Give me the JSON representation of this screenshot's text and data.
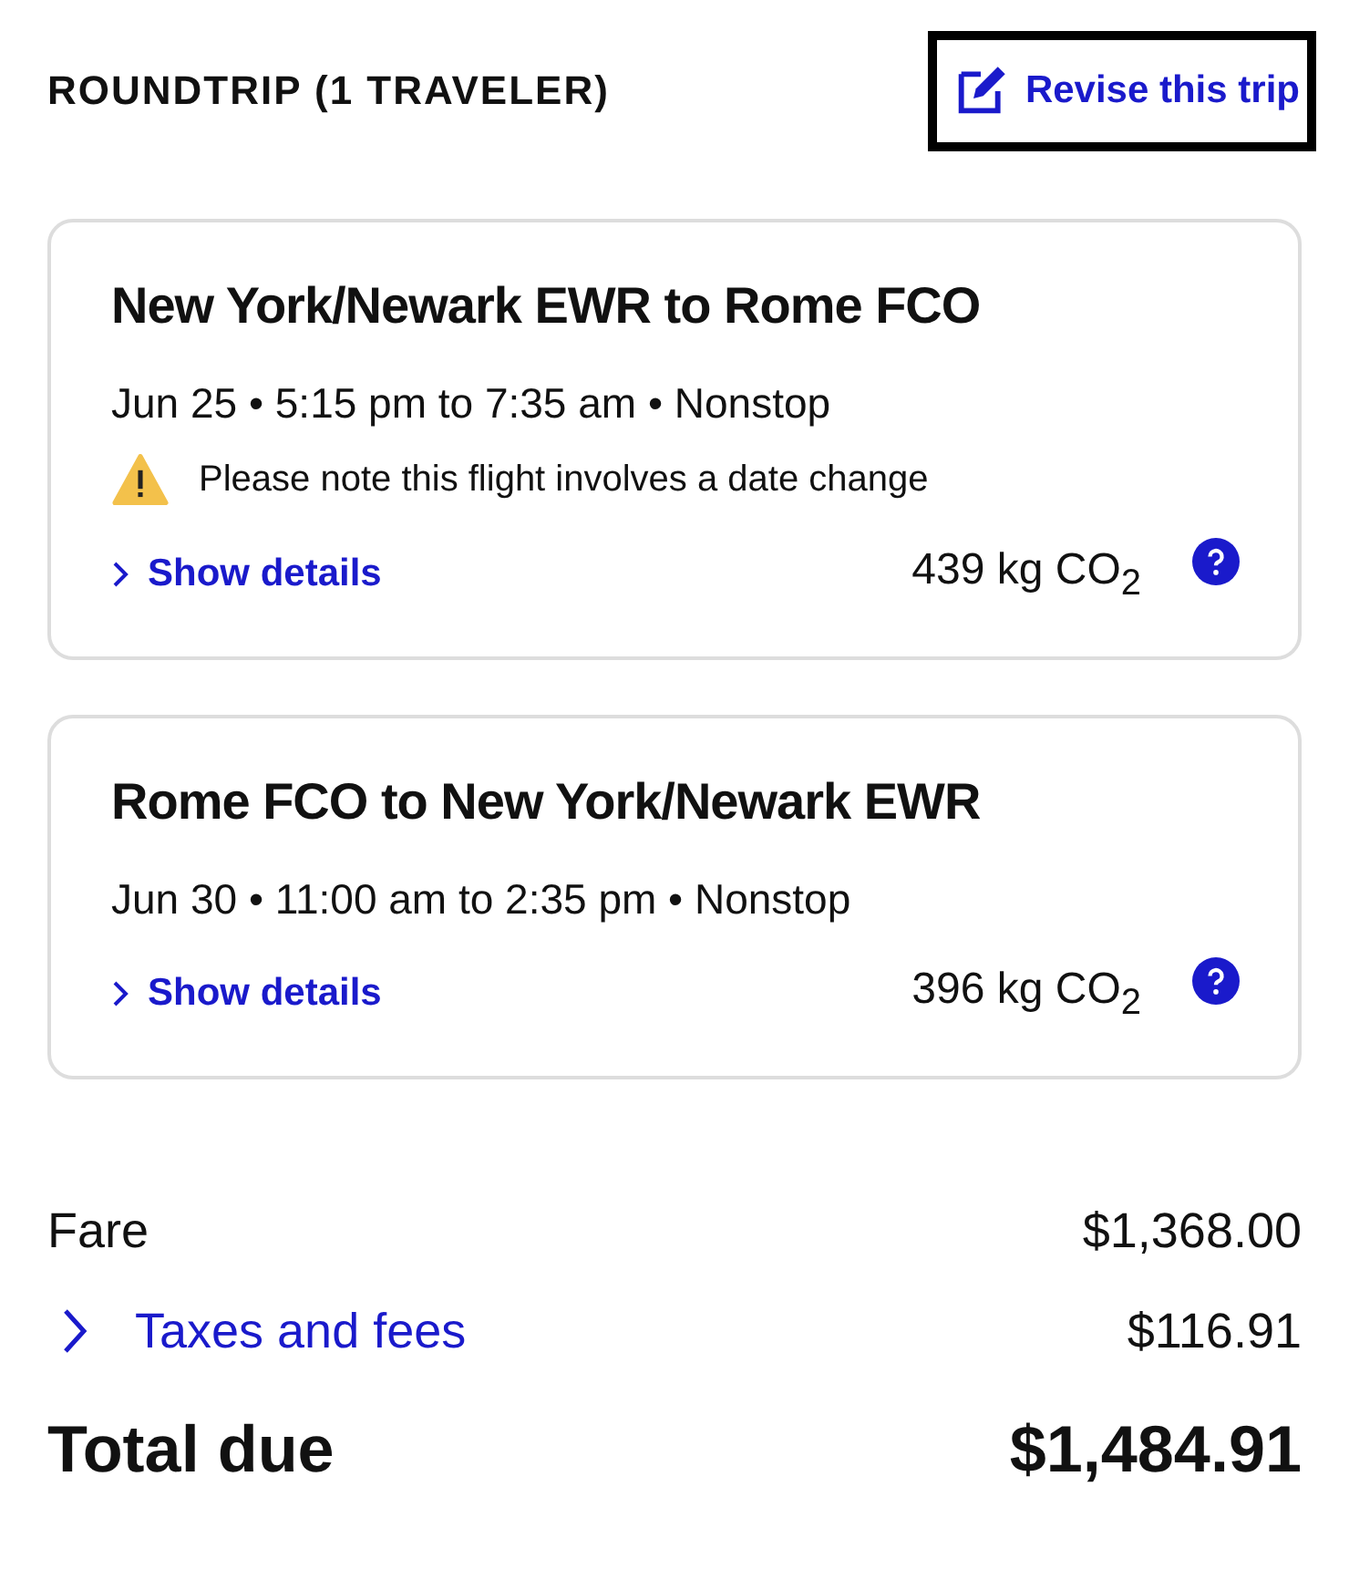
{
  "header": {
    "title": "ROUNDTRIP (1 TRAVELER)",
    "revise_button": "Revise this trip"
  },
  "flights": [
    {
      "route": "New York/Newark EWR to Rome FCO",
      "schedule": "Jun 25 • 5:15 pm to 7:35 am • Nonstop",
      "warning": "Please note this flight involves a date change",
      "details_link": "Show details",
      "emissions": "439 kg CO$_{2}$"
    },
    {
      "route": "Rome FCO to New York/Newark EWR",
      "schedule": "Jun 30 • 11:00 am to 2:35 pm • Nonstop",
      "details_link": "Show details",
      "emissions": "396 kg CO$_{2}$"
    }
  ],
  "price_lines": [
    {
      "kind": "plain",
      "label": "Fare",
      "amount": "$1,368.00"
    },
    {
      "kind": "expandable",
      "label": "Taxes and fees",
      "amount": "$116.91"
    },
    {
      "kind": "total",
      "label": "Total due",
      "amount": "$1,484.91"
    }
  ]
}
